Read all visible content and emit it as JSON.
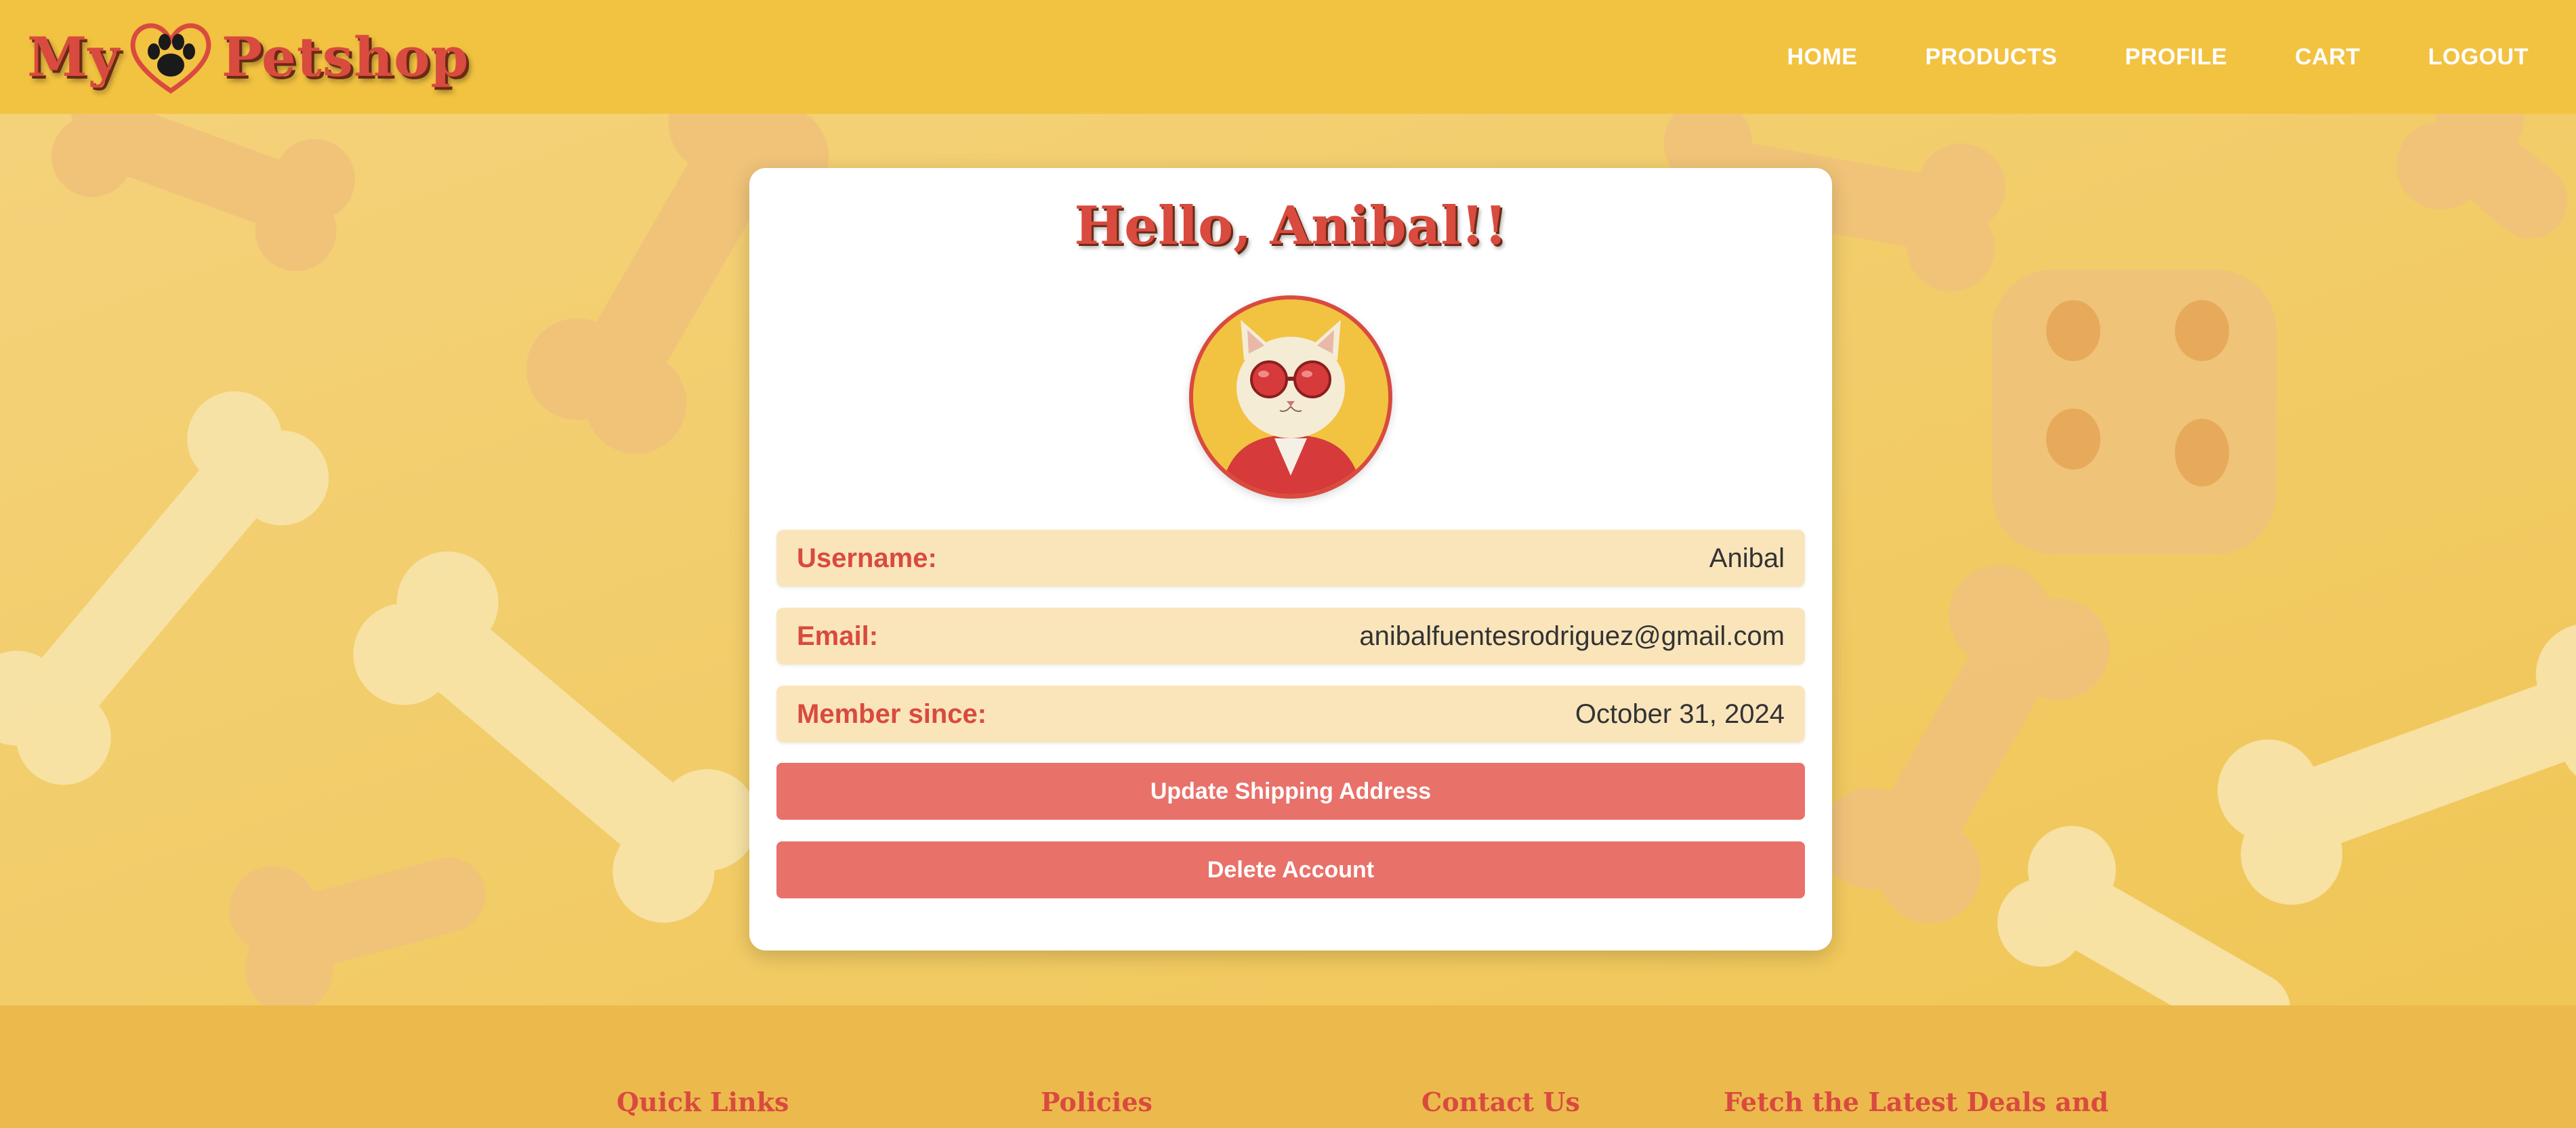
{
  "brand": {
    "name_left": "My",
    "name_right": "Petshop",
    "logo_icon": "heart-paw-icon",
    "accent": "#d94a3f",
    "header_bg": "#f2c241"
  },
  "nav": {
    "items": [
      {
        "label": "HOME"
      },
      {
        "label": "PRODUCTS"
      },
      {
        "label": "PROFILE"
      },
      {
        "label": "CART"
      },
      {
        "label": "LOGOUT"
      }
    ]
  },
  "profile": {
    "greeting": "Hello, Anibal!!",
    "avatar": "cat-with-sunglasses-avatar",
    "fields": [
      {
        "label": "Username:",
        "value": "Anibal"
      },
      {
        "label": "Email:",
        "value": "anibalfuentesrodriguez@gmail.com"
      },
      {
        "label": "Member since:",
        "value": "October 31, 2024"
      }
    ],
    "update_shipping_label": "Update Shipping Address",
    "delete_account_label": "Delete Account",
    "button_color": "#e8716a",
    "field_bg": "#fae5bb"
  },
  "footer": {
    "columns": [
      {
        "title": "Quick Links"
      },
      {
        "title": "Policies"
      },
      {
        "title": "Contact Us"
      },
      {
        "title": "Fetch the Latest Deals and"
      }
    ]
  }
}
